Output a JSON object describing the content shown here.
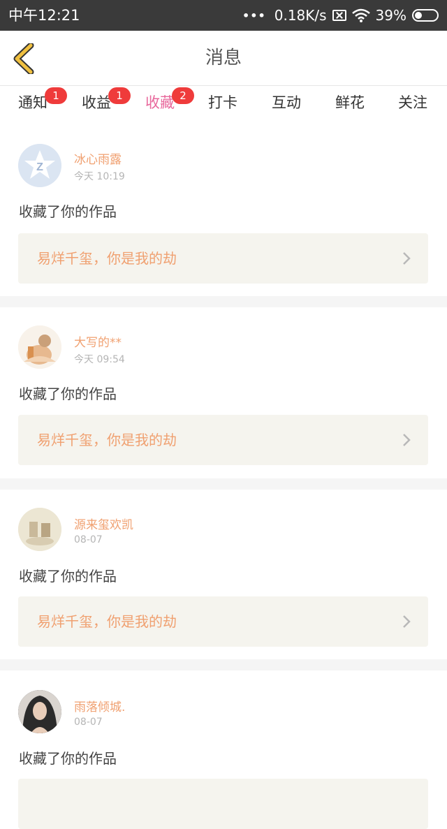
{
  "status_bar": {
    "time": "中午12:21",
    "dots": "•••",
    "network_speed": "0.18K/s",
    "battery": "39%"
  },
  "header": {
    "title": "消息"
  },
  "tabs": [
    {
      "label": "通知",
      "badge": "1",
      "active": false
    },
    {
      "label": "收益",
      "badge": "1",
      "active": false
    },
    {
      "label": "收藏",
      "badge": "2",
      "active": true
    },
    {
      "label": "打卡"
    },
    {
      "label": "互动"
    },
    {
      "label": "鲜花"
    },
    {
      "label": "关注"
    }
  ],
  "feed": [
    {
      "name": "冰心雨露",
      "time": "今天 10:19",
      "action": "收藏了你的作品",
      "work_title": "易烊千玺，你是我的劫"
    },
    {
      "name": "大写的**",
      "time": "今天 09:54",
      "action": "收藏了你的作品",
      "work_title": "易烊千玺，你是我的劫"
    },
    {
      "name": "源来玺欢凯",
      "time": "08-07",
      "action": "收藏了你的作品",
      "work_title": "易烊千玺，你是我的劫"
    },
    {
      "name": "雨落倾城.",
      "time": "08-07",
      "action": "收藏了你的作品"
    }
  ],
  "colors": {
    "accent": "#e8689c",
    "badge": "#ef3b3b",
    "name_orange": "#f0a070",
    "back_arrow": "#f0c040"
  }
}
